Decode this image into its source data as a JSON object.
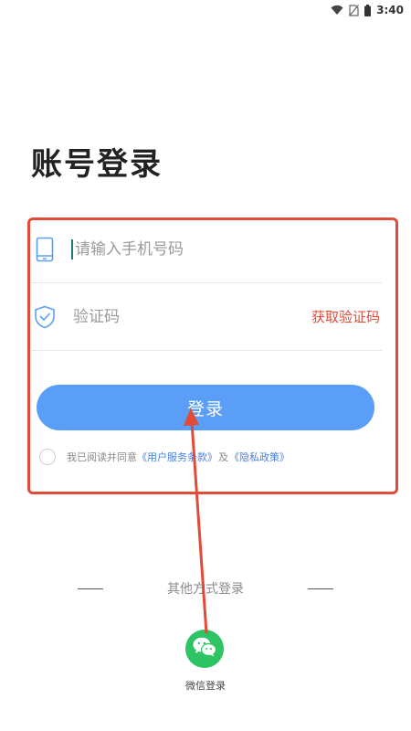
{
  "status_bar": {
    "time": "3:40",
    "icons": [
      "wifi-icon",
      "no-sim-icon",
      "battery-icon"
    ]
  },
  "login": {
    "title": "账号登录",
    "phone_placeholder": "请输入手机号码",
    "code_placeholder": "验证码",
    "get_code_label": "获取验证码",
    "login_button": "登录"
  },
  "agreement": {
    "prefix": "我已阅读并同意",
    "terms_link": "《用户服务条款》",
    "conjunction": "及",
    "privacy_link": "《隐私政策》"
  },
  "other_login": {
    "label": "其他方式登录",
    "wechat_label": "微信登录"
  },
  "colors": {
    "primary_button": "#5b9ef7",
    "accent_red": "#e04b3a",
    "wechat_green": "#2dc563",
    "link_blue": "#4a7fd8"
  }
}
